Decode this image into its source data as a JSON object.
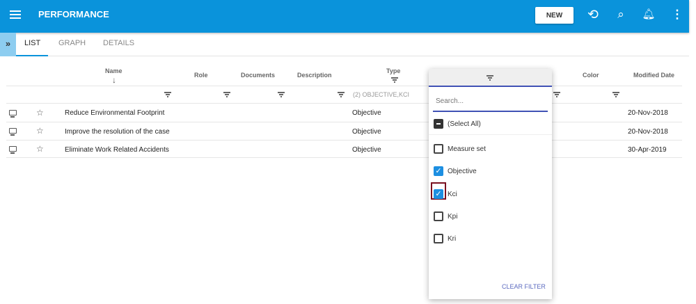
{
  "header": {
    "title": "PERFORMANCE",
    "new_label": "NEW"
  },
  "tabs": [
    {
      "label": "LIST"
    },
    {
      "label": "GRAPH"
    },
    {
      "label": "DETAILS"
    }
  ],
  "table": {
    "columns": [
      "Name",
      "Role",
      "Documents",
      "Description",
      "Type",
      "Color",
      "Modified Date"
    ],
    "type_filter_value": "(2) OBJECTIVE,KCI",
    "rows": [
      {
        "name": "Reduce Environmental Footprint",
        "type": "Objective",
        "modified": "20-Nov-2018"
      },
      {
        "name": "Improve the resolution of the case",
        "type": "Objective",
        "modified": "20-Nov-2018"
      },
      {
        "name": "Eliminate Work Related Accidents",
        "type": "Objective",
        "modified": "30-Apr-2019"
      }
    ]
  },
  "filter_popup": {
    "search_placeholder": "Search...",
    "select_all": "(Select All)",
    "options": [
      {
        "label": "Measure set",
        "checked": false
      },
      {
        "label": "Objective",
        "checked": true
      },
      {
        "label": "Kci",
        "checked": true
      },
      {
        "label": "Kpi",
        "checked": false
      },
      {
        "label": "Kri",
        "checked": false
      }
    ],
    "clear_label": "CLEAR FILTER"
  }
}
